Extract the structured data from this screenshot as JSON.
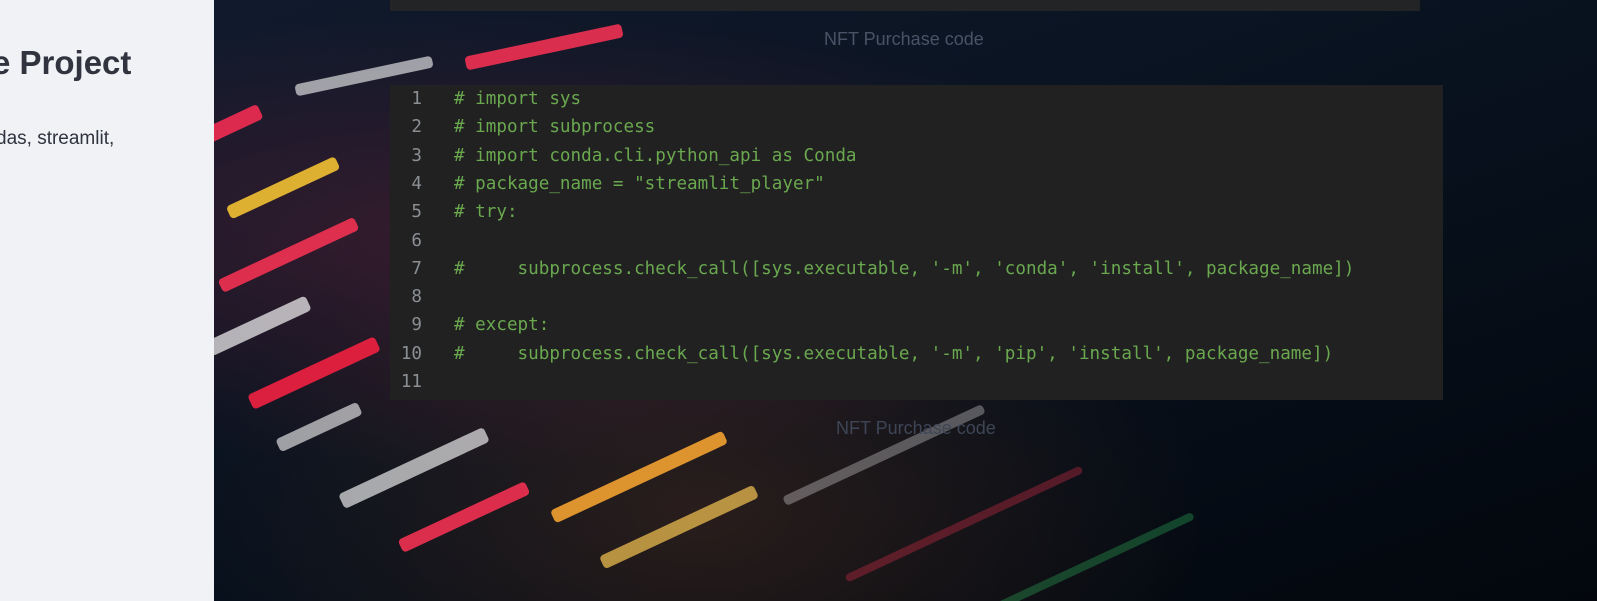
{
  "sidebar": {
    "title": "e Project",
    "text": "das, streamlit,"
  },
  "main": {
    "caption_top": "NFT Purchase code",
    "caption_bottom": "NFT Purchase code",
    "code": {
      "lines": [
        {
          "number": "1",
          "text": "# import sys"
        },
        {
          "number": "2",
          "text": "# import subprocess"
        },
        {
          "number": "3",
          "text": "# import conda.cli.python_api as Conda"
        },
        {
          "number": "4",
          "text": "# package_name = \"streamlit_player\""
        },
        {
          "number": "5",
          "text": "# try:"
        },
        {
          "number": "6",
          "text": ""
        },
        {
          "number": "7",
          "text": "#     subprocess.check_call([sys.executable, '-m', 'conda', 'install', package_name])"
        },
        {
          "number": "8",
          "text": ""
        },
        {
          "number": "9",
          "text": "# except:"
        },
        {
          "number": "10",
          "text": "#     subprocess.check_call([sys.executable, '-m', 'pip', 'install', package_name])"
        },
        {
          "number": "11",
          "text": ""
        }
      ]
    }
  },
  "colors": {
    "sidebar_bg": "#f0f2f6",
    "code_bg": "#212121",
    "code_comment": "#6aa84f",
    "line_number": "#8b8f94"
  }
}
